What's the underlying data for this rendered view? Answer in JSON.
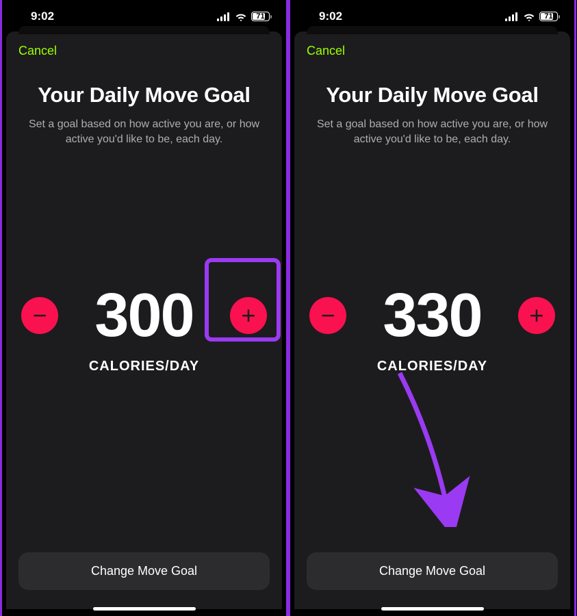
{
  "status": {
    "time": "9:02",
    "battery": "71"
  },
  "common": {
    "cancel": "Cancel",
    "title": "Your Daily Move Goal",
    "subtitle": "Set a goal based on how active you are, or how active you'd like to be, each day.",
    "unit": "CALORIES/DAY",
    "button": "Change Move Goal",
    "minus": "−",
    "plus": "+"
  },
  "screens": [
    {
      "goal": "300"
    },
    {
      "goal": "330"
    }
  ]
}
